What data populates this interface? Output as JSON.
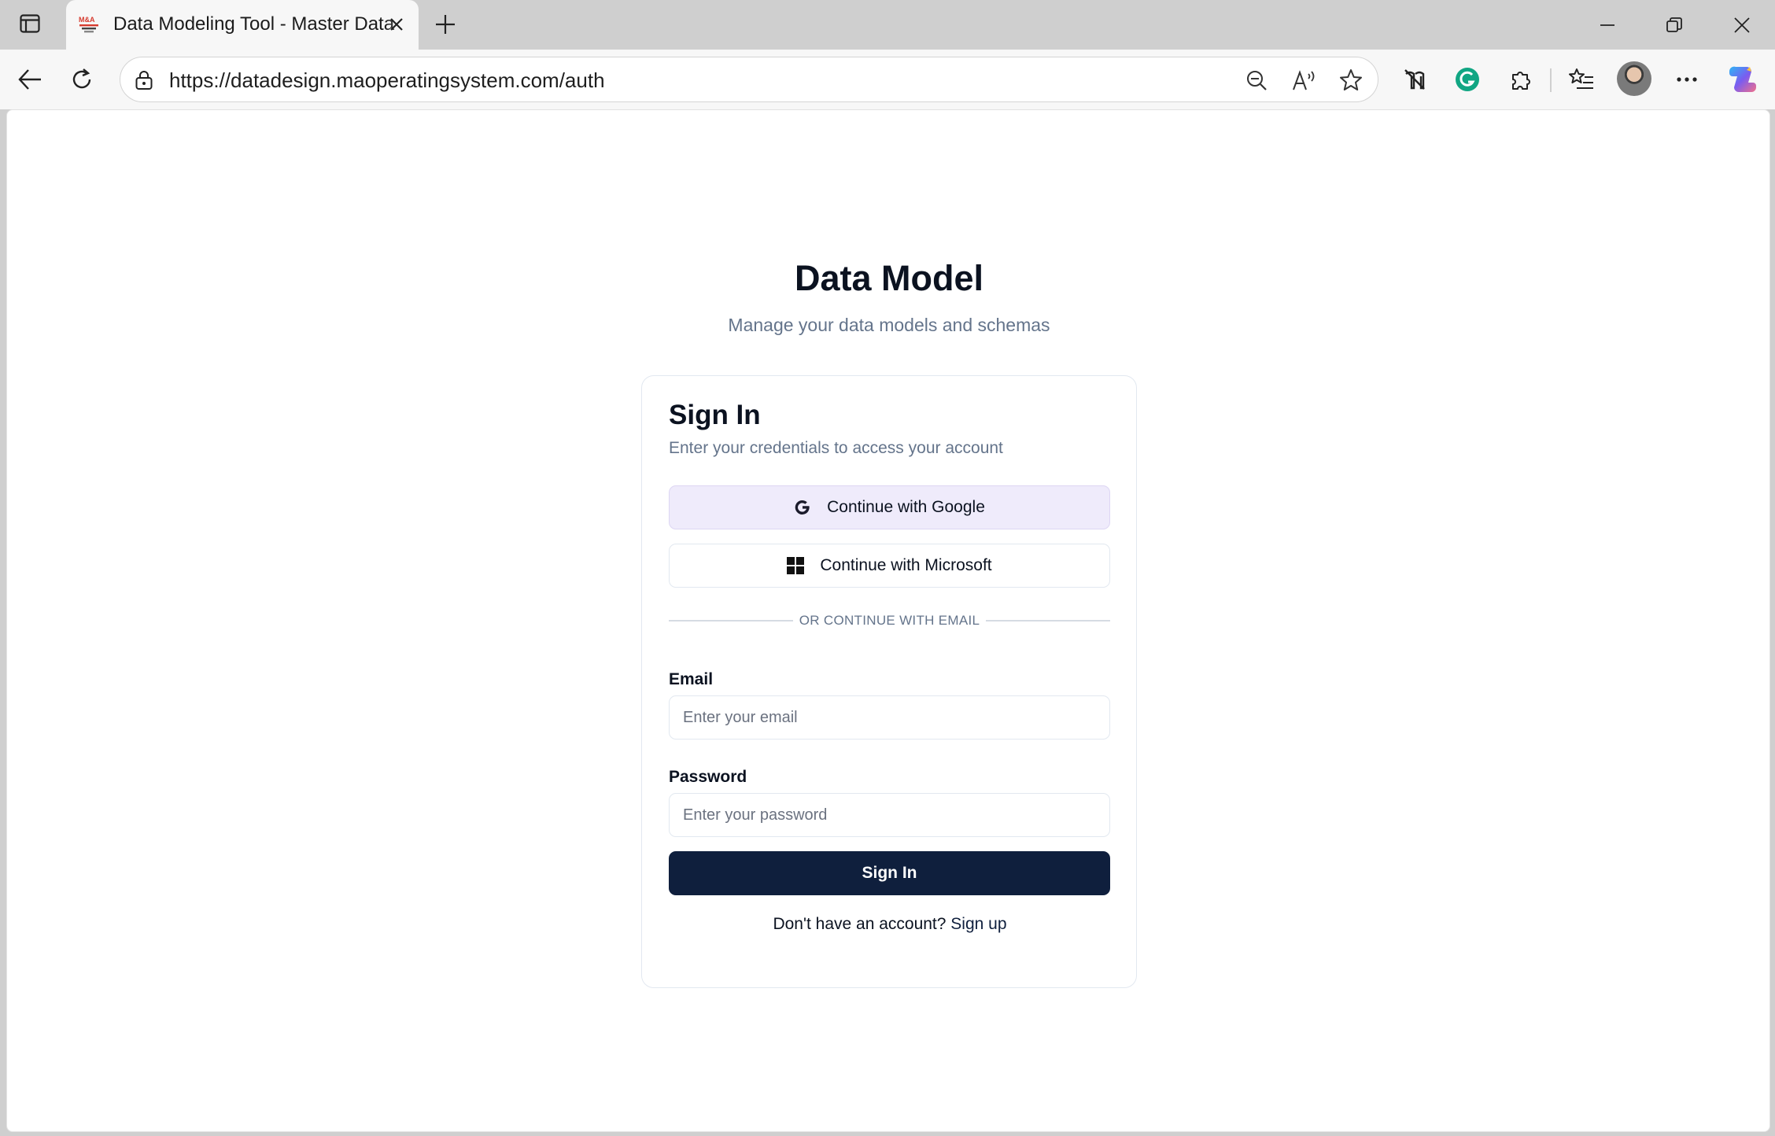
{
  "browser": {
    "tab": {
      "title": "Data Modeling Tool - Master Data",
      "favicon_text": "M&A"
    },
    "url": "https://datadesign.maoperatingsystem.com/auth"
  },
  "page": {
    "title": "Data Model",
    "subtitle": "Manage your data models and schemas"
  },
  "signin": {
    "title": "Sign In",
    "subtitle": "Enter your credentials to access your account",
    "google_label": "Continue with Google",
    "microsoft_label": "Continue with Microsoft",
    "divider_text": "OR CONTINUE WITH EMAIL",
    "email_label": "Email",
    "email_placeholder": "Enter your email",
    "email_value": "",
    "password_label": "Password",
    "password_placeholder": "Enter your password",
    "password_value": "",
    "submit_label": "Sign In",
    "signup_prompt": "Don't have an account?",
    "signup_link": "Sign up"
  },
  "colors": {
    "primary": "#0f1f3d",
    "google_button_bg": "#efebfb",
    "muted_text": "#64748b"
  }
}
